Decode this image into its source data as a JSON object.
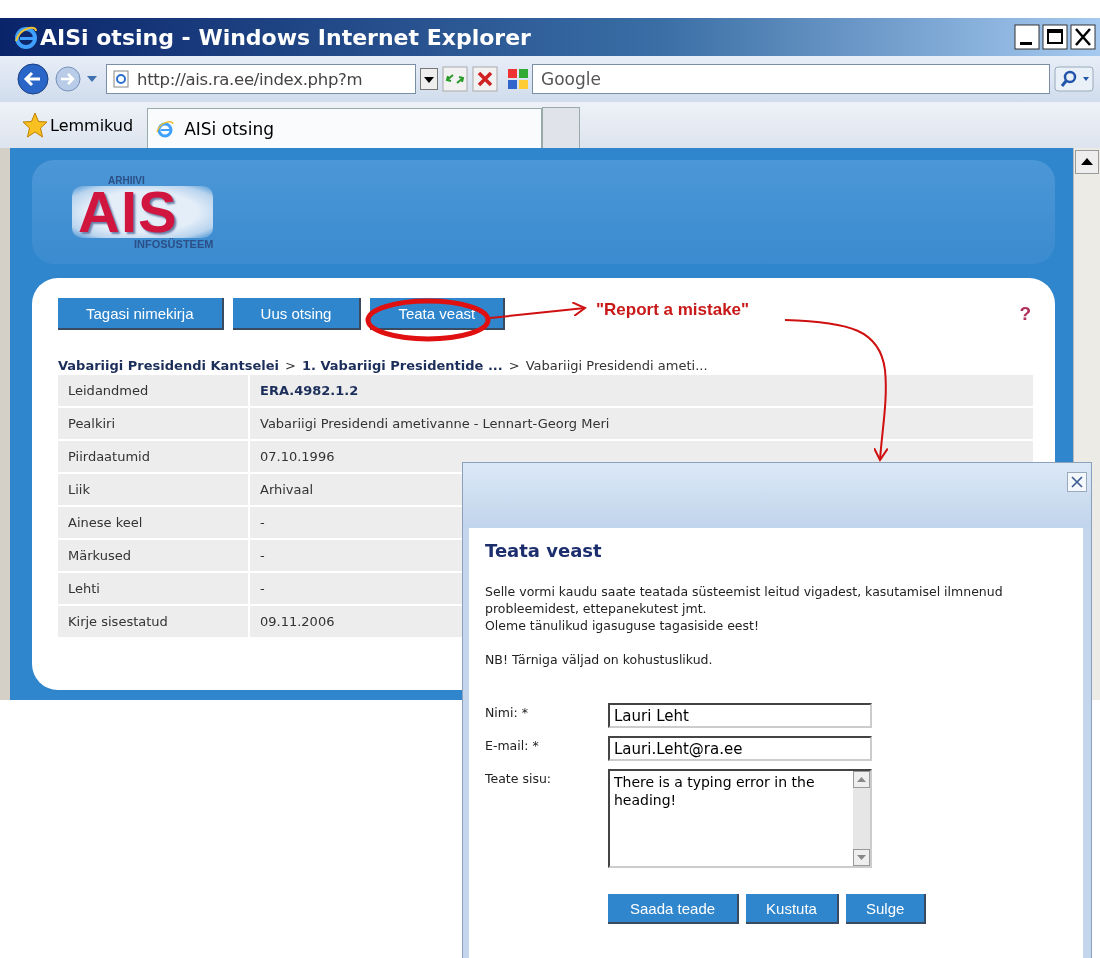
{
  "window": {
    "title": "AISi otsing - Windows Internet Explorer"
  },
  "toolbar": {
    "address": "http://ais.ra.ee/index.php?m",
    "search_placeholder": "Google"
  },
  "favorites_bar": {
    "label": "Lemmikud",
    "tabs": [
      {
        "label": "AISi otsing",
        "selected": true
      }
    ]
  },
  "logo": {
    "top": "ARHIIVI",
    "main": "AIS",
    "bottom": "INFOSÜSTEEM"
  },
  "actions": [
    {
      "label": "Tagasi nimekirja"
    },
    {
      "label": "Uus otsing"
    },
    {
      "label": "Teata veast"
    }
  ],
  "help": "?",
  "breadcrumb": [
    {
      "text": "Vabariigi Presidendi Kantselei",
      "kind": "link"
    },
    {
      "text": ">",
      "kind": "separator"
    },
    {
      "text": "1. Vabariigi Presidentide ...",
      "kind": "link"
    },
    {
      "text": ">",
      "kind": "separator"
    },
    {
      "text": "Vabariigi Presidendi ameti...",
      "kind": "current"
    }
  ],
  "details": {
    "rows": [
      {
        "label": "Leidandmed",
        "value": "ERA.4982.1.2",
        "emphasis": true
      },
      {
        "label": "Pealkiri",
        "value": "Vabariigi Presidendi ametivanne - Lennart-Georg Meri",
        "emphasis": false
      },
      {
        "label": "Piirdaatumid",
        "value": "07.10.1996",
        "emphasis": false
      },
      {
        "label": "Liik",
        "value": "Arhivaal",
        "emphasis": false
      },
      {
        "label": "Ainese keel",
        "value": "-",
        "emphasis": false
      },
      {
        "label": "Märkused",
        "value": "-",
        "emphasis": false
      },
      {
        "label": "Lehti",
        "value": "-",
        "emphasis": false
      },
      {
        "label": "Kirje sisestatud",
        "value": "09.11.2006",
        "emphasis": false
      }
    ]
  },
  "annotation": {
    "text": "\"Report a mistake\""
  },
  "dialog": {
    "title": "Teata veast",
    "intro": [
      "Selle vormi kaudu saate teatada süsteemist leitud vigadest, kasutamisel ilmnenud probleemidest, ettepanekutest jmt.",
      "Oleme tänulikud igasuguse tagasiside eest!"
    ],
    "note": "NB! Tärniga väljad on kohustuslikud.",
    "fields": [
      {
        "label": "Nimi: *",
        "value": "Lauri Leht",
        "kind": "text"
      },
      {
        "label": "E-mail: *",
        "value": "Lauri.Leht@ra.ee",
        "kind": "text"
      },
      {
        "label": "Teate sisu:",
        "value": "There is a typing error in the heading!",
        "kind": "textarea"
      }
    ],
    "buttons": [
      "Saada teade",
      "Kustuta",
      "Sulge"
    ]
  }
}
